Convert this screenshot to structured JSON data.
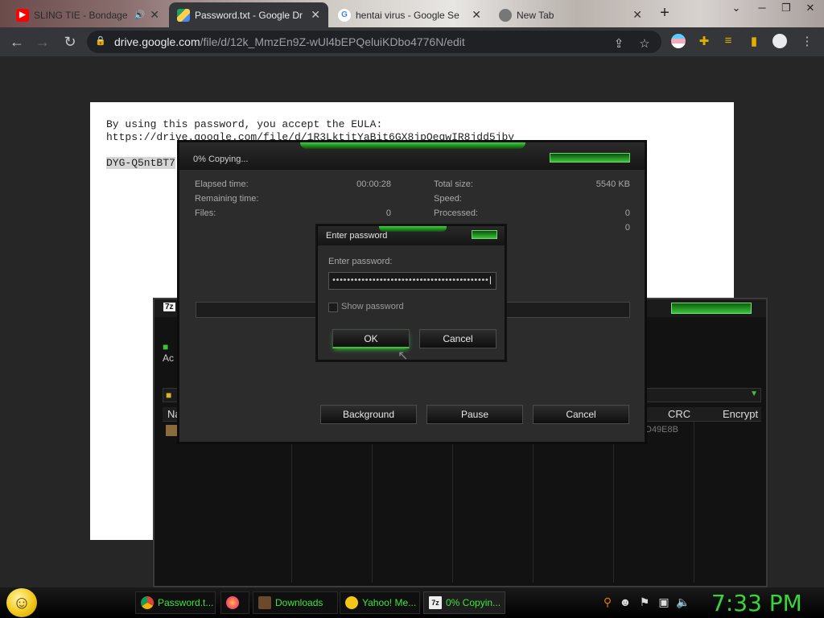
{
  "browser": {
    "tabs": [
      {
        "title": "SLING TIE - Bondage",
        "icon": "youtube-icon",
        "color": "#ff0000"
      },
      {
        "title": "Password.txt - Google Dr",
        "icon": "google-drive-icon",
        "color": "#1fa463"
      },
      {
        "title": "hentai virus - Google Se",
        "icon": "google-icon",
        "color": "#4285f4"
      },
      {
        "title": "New Tab",
        "icon": "chrome-icon",
        "color": "#777777"
      }
    ],
    "new_tab": "+",
    "url_domain": "drive.google.com",
    "url_path": "/file/d/12k_MmzEn9Z-wUl4bEPQeluiKDbo4776N/edit"
  },
  "document": {
    "line1": "By using this password, you accept the EULA:",
    "line2": "https://drive.google.com/file/d/1R3LktjtYaBit6GX8jpOeqwIR8jdd5jby",
    "line3": "DYG-Q5ntBT7"
  },
  "copy_dialog": {
    "title": "0% Copying...",
    "elapsed_label": "Elapsed time:",
    "elapsed_value": "00:00:28",
    "remaining_label": "Remaining time:",
    "files_label": "Files:",
    "files_value": "0",
    "total_label": "Total size:",
    "total_value": "5540 KB",
    "speed_label": "Speed:",
    "processed_label": "Processed:",
    "processed_value": "0",
    "extra_value": "0",
    "background_btn": "Background",
    "pause_btn": "Pause",
    "cancel_btn": "Cancel"
  },
  "password_dialog": {
    "title": "Enter password",
    "field_label": "Enter password:",
    "masked_value": "•••••••••••••••••••••••••••••••••••••••••••",
    "show_password": "Show password",
    "ok_btn": "OK",
    "cancel_btn": "Cancel"
  },
  "zip_window": {
    "logo": "7z",
    "toolbar_label": "Ac",
    "col_name": "Na",
    "col_crc": "CRC",
    "col_encrypt": "Encrypt",
    "crc_value": "D49E8B"
  },
  "taskbar": {
    "items": [
      {
        "label": "Password.t...",
        "icon": "chrome-icon"
      },
      {
        "label": "",
        "icon": "firefox-icon"
      },
      {
        "label": "Downloads",
        "icon": "folder-icon"
      },
      {
        "label": "Yahoo! Me...",
        "icon": "yahoo-messenger-icon"
      },
      {
        "label": "0% Copyin...",
        "icon": "7zip-icon"
      }
    ],
    "clock": "7:33 PM"
  }
}
